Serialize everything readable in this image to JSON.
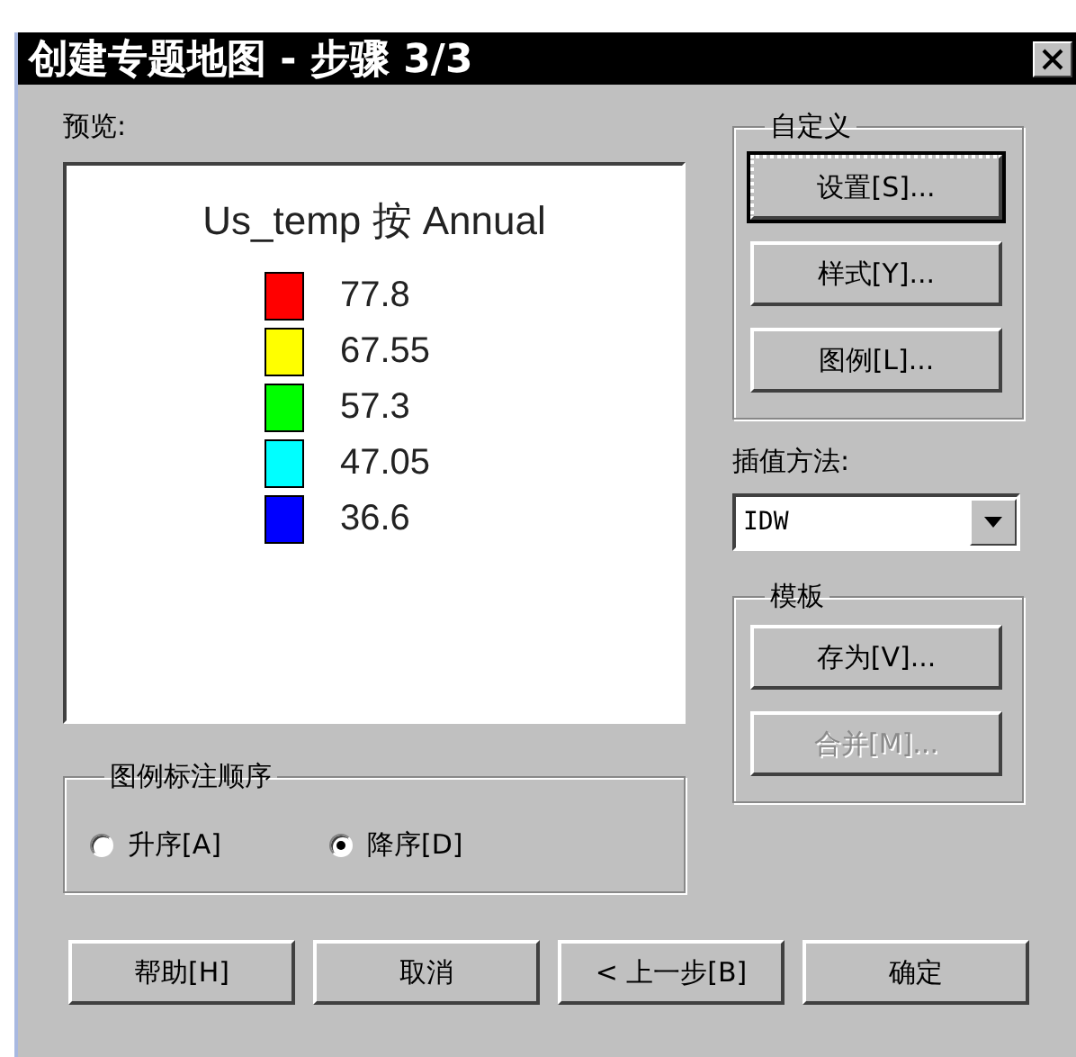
{
  "window": {
    "title": "创建专题地图 - 步骤 3/3"
  },
  "preview": {
    "label": "预览:",
    "title": "Us_temp 按 Annual",
    "legend": [
      {
        "color": "#ff0000",
        "value": "77.8"
      },
      {
        "color": "#ffff00",
        "value": "67.55"
      },
      {
        "color": "#00ff00",
        "value": "57.3"
      },
      {
        "color": "#00ffff",
        "value": "47.05"
      },
      {
        "color": "#0000ff",
        "value": "36.6"
      }
    ]
  },
  "order_group": {
    "label": "图例标注顺序",
    "options": [
      {
        "label": "升序[A]",
        "selected": false
      },
      {
        "label": "降序[D]",
        "selected": true
      }
    ]
  },
  "custom_group": {
    "label": "自定义",
    "buttons": [
      {
        "label": "设置[S]...",
        "focused": true,
        "disabled": false
      },
      {
        "label": "样式[Y]...",
        "focused": false,
        "disabled": false
      },
      {
        "label": "图例[L]...",
        "focused": false,
        "disabled": false
      }
    ]
  },
  "interpolation": {
    "label": "插值方法:",
    "value": "IDW"
  },
  "template_group": {
    "label": "模板",
    "buttons": [
      {
        "label": "存为[V]...",
        "focused": false,
        "disabled": false
      },
      {
        "label": "合并[M]...",
        "focused": false,
        "disabled": true
      }
    ]
  },
  "buttons": [
    {
      "label": "帮助[H]"
    },
    {
      "label": "取消"
    },
    {
      "label": "< 上一步[B]"
    },
    {
      "label": "确定"
    }
  ]
}
